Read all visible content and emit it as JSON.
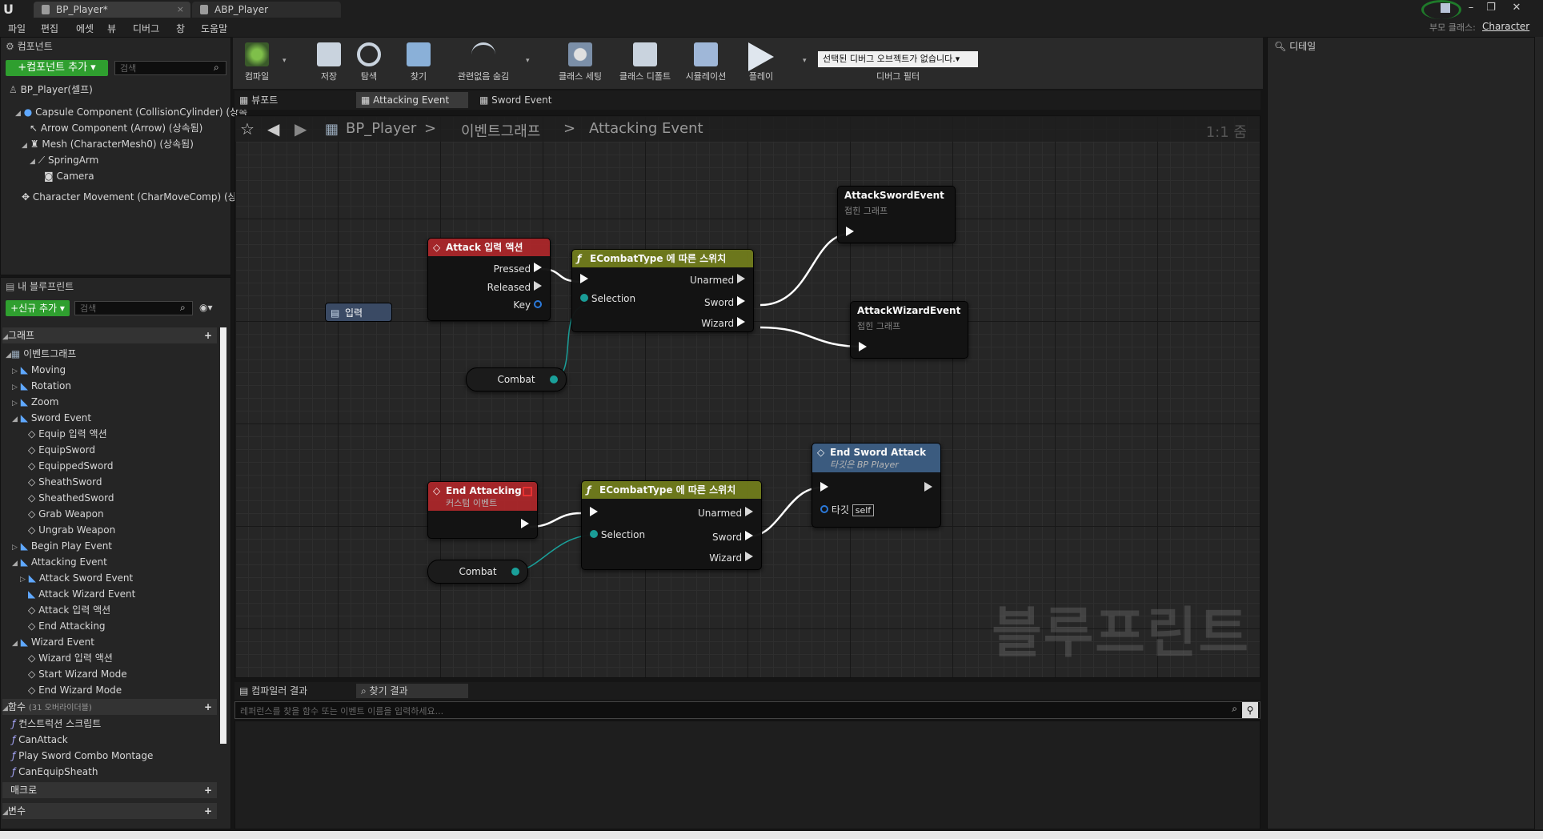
{
  "titlebar": {
    "tabs": [
      {
        "label": "BP_Player*"
      },
      {
        "label": "ABP_Player"
      }
    ]
  },
  "menubar": {
    "items": [
      "파일",
      "편집",
      "에셋",
      "뷰",
      "디버그",
      "창",
      "도움말"
    ],
    "parent_class_label": "부모 클래스:",
    "parent_class_value": "Character"
  },
  "components_panel": {
    "tab": "컴포넌트",
    "add_button": "+컴포넌트 추가 ▾",
    "search_placeholder": "검색",
    "root": "BP_Player(셀프)",
    "items": [
      "Capsule Component (CollisionCylinder) (상속",
      "Arrow Component (Arrow) (상속됨)",
      "Mesh (CharacterMesh0) (상속됨)",
      "SpringArm",
      "Camera",
      "Character Movement (CharMoveComp) (상속"
    ]
  },
  "my_blueprint": {
    "tab": "내 블루프린트",
    "add_new": "+신규 추가 ▾",
    "search_placeholder": "검색",
    "graphs_header": "그래프",
    "event_graph": "이벤트그래프",
    "items": [
      "Moving",
      "Rotation",
      "Zoom",
      "Sword Event",
      "Equip 입력 액션",
      "EquipSword",
      "EquippedSword",
      "SheathSword",
      "SheathedSword",
      "Grab Weapon",
      "Ungrab Weapon",
      "Begin Play Event",
      "Attacking Event",
      "Attack Sword Event",
      "Attack Wizard Event",
      "Attack 입력 액션",
      "End Attacking",
      "Wizard Event",
      "Wizard 입력 액션",
      "Start Wizard Mode",
      "End Wizard Mode"
    ],
    "functions_header": "함수",
    "functions_override": "(31 오버라이더블)",
    "functions": [
      "컨스트럭션 스크립트",
      "CanAttack",
      "Play Sword Combo Montage",
      "CanEquipSheath"
    ],
    "macros_header": "매크로",
    "variables_header": "변수"
  },
  "toolbar": {
    "compile": "컴파일",
    "save": "저장",
    "browse": "탐색",
    "find": "찾기",
    "hide_unrelated": "관련없음 숨김",
    "class_settings": "클래스 세팅",
    "class_defaults": "클래스 디폴트",
    "simulation": "시뮬레이션",
    "play": "플레이",
    "debug_dropdown": "선택된 디버그 오브젝트가 없습니다.▾",
    "debug_filter": "디버그 필터"
  },
  "details_panel": {
    "tab": "디테일"
  },
  "graph_tabs": [
    "뷰포트",
    "Attacking Event",
    "Sword Event"
  ],
  "breadcrumb": {
    "root": "BP_Player",
    "sep": ">",
    "graph": "이벤트그래프",
    "current": "Attacking Event",
    "zoom": "1:1 줌"
  },
  "nodes": {
    "input_label": "입력",
    "attack_action": {
      "title": "Attack 입력 액션",
      "pressed": "Pressed",
      "released": "Released",
      "key": "Key"
    },
    "switch1": {
      "title": "ECombatType 에 따른 스위치",
      "unarmed": "Unarmed",
      "selection": "Selection",
      "sword": "Sword",
      "wizard": "Wizard"
    },
    "combat1": "Combat",
    "attack_sword_event": {
      "title": "AttackSwordEvent",
      "sub": "접힌 그래프"
    },
    "attack_wizard_event": {
      "title": "AttackWizardEvent",
      "sub": "접힌 그래프"
    },
    "end_attacking": {
      "title": "End Attacking",
      "sub": "커스텀 이벤트"
    },
    "switch2": {
      "title": "ECombatType 에 따른 스위치",
      "unarmed": "Unarmed",
      "selection": "Selection",
      "sword": "Sword",
      "wizard": "Wizard"
    },
    "combat2": "Combat",
    "end_sword_attack": {
      "title": "End Sword Attack",
      "sub": "타깃은 BP Player",
      "target": "타깃",
      "self": "self"
    },
    "watermark": "블루프린트"
  },
  "bottom": {
    "tabs": [
      "컴파일러 결과",
      "찾기 결과"
    ],
    "find_placeholder": "레퍼런스를 찾을 함수 또는 이벤트 이름을 입력하세요..."
  }
}
